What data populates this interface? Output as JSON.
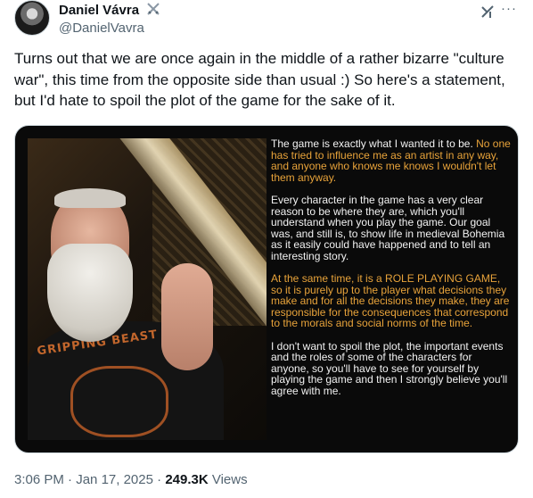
{
  "author": {
    "display_name": "Daniel Vávra",
    "handle": "@DanielVavra",
    "badge_icon": "crossed-swords-icon"
  },
  "header_icons": [
    "grok-icon",
    "more-icon"
  ],
  "more_label": "···",
  "tweet": {
    "text": "Turns out that we are once again in the middle of a rather bizarre \"culture war\", this time from the opposite side than usual :) So here's a statement, but I'd hate to spoil the plot of the game for the sake of it."
  },
  "image": {
    "shirt_text": "GRIPPING BEAST",
    "statement": {
      "p1_white": "The game is exactly what I wanted it to be.",
      "p1_yellow": "No one has tried to influence me as an artist in any way, and anyone who knows me knows I wouldn't let them anyway.",
      "p2_white": "Every character in the game has a very clear reason to be where they are, which you'll understand when you play the game. Our goal was, and still is, to show life in medieval Bohemia as it easily could have happened and to tell an interesting story.",
      "p3_yellow": "At the same time, it is a ROLE PLAYING GAME, so it is purely up to the player what decisions they make and for all the decisions they make, they are responsible for the consequences that correspond to the morals and social norms of the time.",
      "p4_white": "I don't want to spoil the plot, the important events and the roles of some of the characters for anyone, so you'll have to see for yourself by playing the game and then I strongly believe you'll agree with me."
    },
    "colors": {
      "white_text": "#f2f2f2",
      "yellow_text": "#e8a33a",
      "background": "#0a0a0a"
    }
  },
  "meta": {
    "time": "3:06 PM",
    "separator": "·",
    "date": "Jan 17, 2025",
    "views_count": "249.3K",
    "views_label": "Views"
  }
}
